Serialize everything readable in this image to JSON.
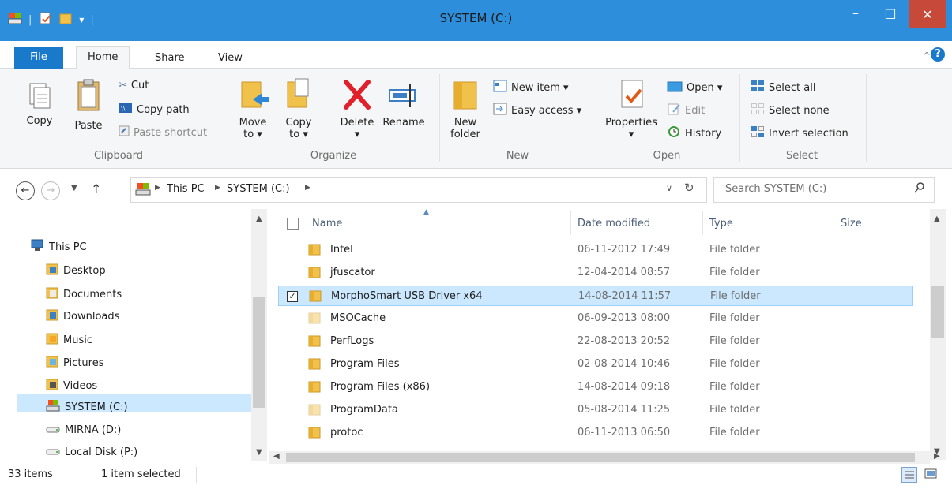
{
  "window": {
    "title": "SYSTEM (C:)",
    "minimize_glyph": "–",
    "maximize_glyph": "□",
    "close_glyph": "✕"
  },
  "ribbon_tabs": {
    "file": "File",
    "home": "Home",
    "share": "Share",
    "view": "View"
  },
  "clipboard": {
    "copy": "Copy",
    "paste": "Paste",
    "cut": "Cut",
    "copy_path": "Copy path",
    "paste_shortcut": "Paste shortcut",
    "label": "Clipboard"
  },
  "organize": {
    "move_to_1": "Move",
    "move_to_2": "to ▾",
    "copy_to_1": "Copy",
    "copy_to_2": "to ▾",
    "delete": "Delete",
    "delete_arrow": "▾",
    "rename": "Rename",
    "label": "Organize"
  },
  "new_group": {
    "new_folder_1": "New",
    "new_folder_2": "folder",
    "new_item": "New item ▾",
    "easy_access": "Easy access ▾",
    "label": "New"
  },
  "open_group": {
    "properties": "Properties",
    "properties_arrow": "▾",
    "open": "Open ▾",
    "edit": "Edit",
    "history": "History",
    "label": "Open"
  },
  "select_group": {
    "select_all": "Select all",
    "select_none": "Select none",
    "invert": "Invert selection",
    "label": "Select"
  },
  "address": {
    "crumbs": [
      "This PC",
      "SYSTEM (C:)"
    ],
    "search_placeholder": "Search SYSTEM (C:)"
  },
  "nav": {
    "items": [
      {
        "label": "This PC",
        "icon": "pc-icon"
      },
      {
        "label": "Desktop",
        "icon": "desktop-icon"
      },
      {
        "label": "Documents",
        "icon": "documents-icon"
      },
      {
        "label": "Downloads",
        "icon": "downloads-icon"
      },
      {
        "label": "Music",
        "icon": "music-icon"
      },
      {
        "label": "Pictures",
        "icon": "pictures-icon"
      },
      {
        "label": "Videos",
        "icon": "videos-icon"
      },
      {
        "label": "SYSTEM (C:)",
        "icon": "system-drive-icon"
      },
      {
        "label": "MIRNA (D:)",
        "icon": "drive-icon"
      },
      {
        "label": "Local Disk (P:)",
        "icon": "drive-icon"
      }
    ]
  },
  "columns": {
    "name": "Name",
    "date": "Date modified",
    "type": "Type",
    "size": "Size"
  },
  "files": [
    {
      "name": "Intel",
      "date": "06-11-2012 17:49",
      "type": "File folder",
      "hidden": false
    },
    {
      "name": "jfuscator",
      "date": "12-04-2014 08:57",
      "type": "File folder",
      "hidden": false
    },
    {
      "name": "MorphoSmart USB Driver x64",
      "date": "14-08-2014 11:57",
      "type": "File folder",
      "hidden": false
    },
    {
      "name": "MSOCache",
      "date": "06-09-2013 08:00",
      "type": "File folder",
      "hidden": true
    },
    {
      "name": "PerfLogs",
      "date": "22-08-2013 20:52",
      "type": "File folder",
      "hidden": false
    },
    {
      "name": "Program Files",
      "date": "02-08-2014 10:46",
      "type": "File folder",
      "hidden": false
    },
    {
      "name": "Program Files (x86)",
      "date": "14-08-2014 09:18",
      "type": "File folder",
      "hidden": false
    },
    {
      "name": "ProgramData",
      "date": "05-08-2014 11:25",
      "type": "File folder",
      "hidden": true
    },
    {
      "name": "protoc",
      "date": "06-11-2013 06:50",
      "type": "File folder",
      "hidden": false
    }
  ],
  "selected_file_index": 2,
  "status": {
    "count": "33 items",
    "selected": "1 item selected"
  },
  "colors": {
    "titlebar": "#2d8fdc",
    "file_tab": "#1979ca",
    "selection": "#cce8ff",
    "close": "#c7493a"
  }
}
